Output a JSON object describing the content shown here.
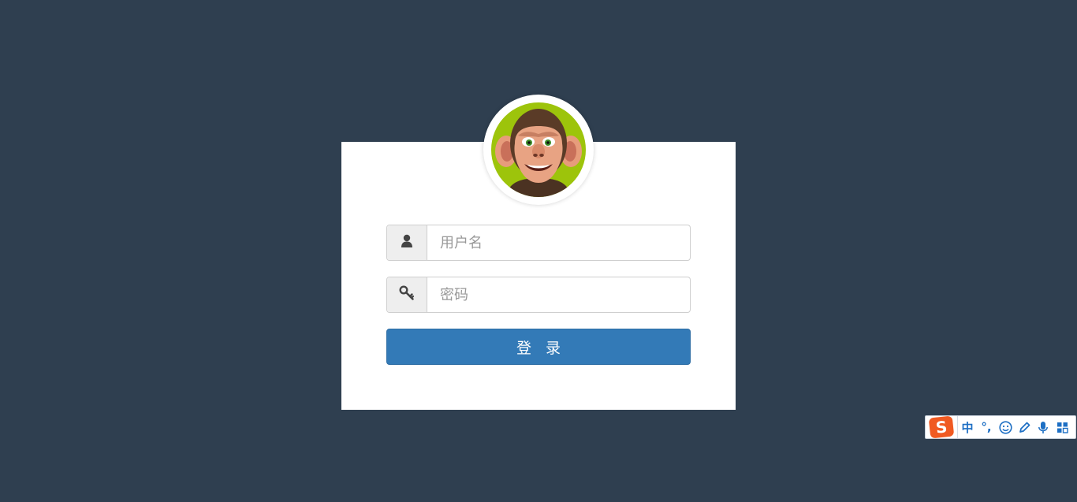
{
  "login": {
    "username_placeholder": "用户名",
    "password_placeholder": "密码",
    "submit_label": "登 录"
  },
  "ime_toolbar": {
    "logo_letter": "S",
    "mode_label": "中",
    "punct_label": "°,"
  },
  "colors": {
    "page_background": "#2f3f50",
    "card_background": "#ffffff",
    "primary_button": "#337ab7",
    "avatar_background": "#9dc40b",
    "ime_logo": "#f05a22",
    "ime_icon": "#1d6fc4"
  },
  "icons": {
    "username_addon": "user-icon",
    "password_addon": "key-icon",
    "avatar": "monkey-avatar"
  }
}
